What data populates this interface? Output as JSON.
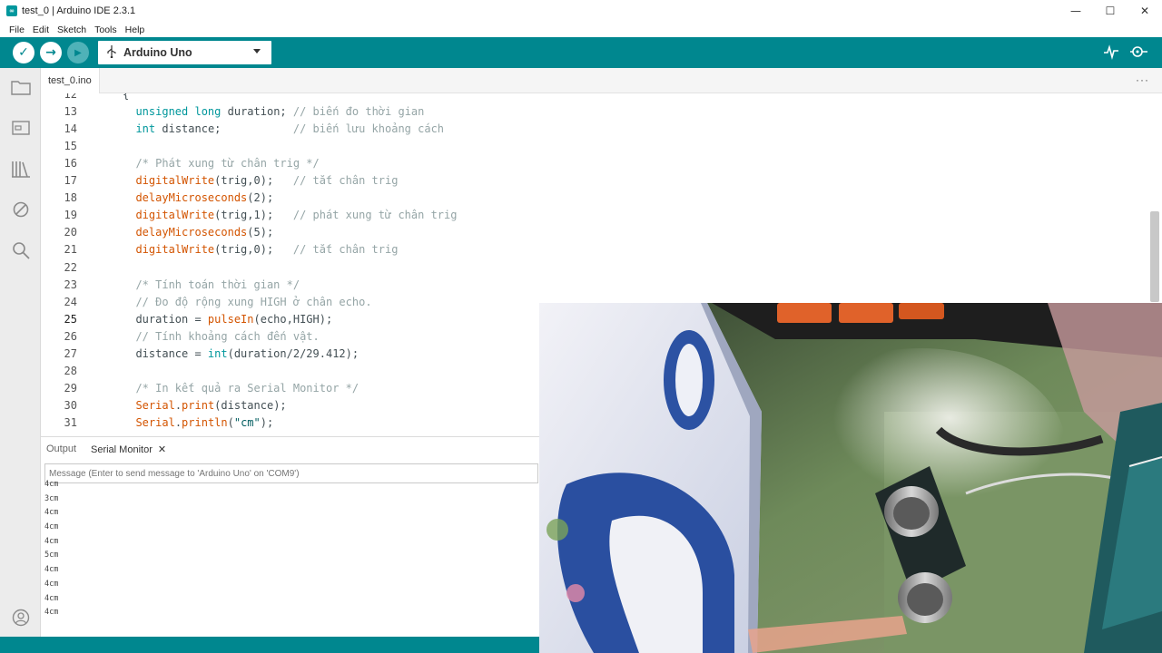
{
  "window": {
    "title": "test_0 | Arduino IDE 2.3.1",
    "logo": "arduino-logo-icon",
    "controls": {
      "minimize": "—",
      "maximize": "☐",
      "close": "✕"
    }
  },
  "menu": [
    "File",
    "Edit",
    "Sketch",
    "Tools",
    "Help"
  ],
  "toolbar": {
    "verify_icon": "✓",
    "upload_icon": "→",
    "debug_icon": "▶",
    "board_icon": "⭠",
    "board": "Arduino Uno",
    "plotter_icon": "⌁",
    "monitor_icon": "⚲"
  },
  "tabs": [
    {
      "label": "test_0.ino"
    }
  ],
  "tab_more": "···",
  "editor": {
    "current_line": "25",
    "lines": [
      {
        "n": "12",
        "code": "{"
      },
      {
        "n": "13",
        "code": "  unsigned long duration; // biến đo thời gian"
      },
      {
        "n": "14",
        "code": "  int distance;           // biến lưu khoảng cách"
      },
      {
        "n": "15",
        "code": ""
      },
      {
        "n": "16",
        "code": "  /* Phát xung từ chân trig */"
      },
      {
        "n": "17",
        "code": "  digitalWrite(trig,0);   // tắt chân trig"
      },
      {
        "n": "18",
        "code": "  delayMicroseconds(2);"
      },
      {
        "n": "19",
        "code": "  digitalWrite(trig,1);   // phát xung từ chân trig"
      },
      {
        "n": "20",
        "code": "  delayMicroseconds(5);"
      },
      {
        "n": "21",
        "code": "  digitalWrite(trig,0);   // tắt chân trig"
      },
      {
        "n": "22",
        "code": ""
      },
      {
        "n": "23",
        "code": "  /* Tính toán thời gian */"
      },
      {
        "n": "24",
        "code": "  // Đo độ rộng xung HIGH ở chân echo."
      },
      {
        "n": "25",
        "code": "  duration = pulseIn(echo,HIGH);"
      },
      {
        "n": "26",
        "code": "  // Tính khoảng cách đến vật."
      },
      {
        "n": "27",
        "code": "  distance = int(duration/2/29.412);"
      },
      {
        "n": "28",
        "code": ""
      },
      {
        "n": "29",
        "code": "  /* In kết quả ra Serial Monitor */"
      },
      {
        "n": "30",
        "code": "  Serial.print(distance);"
      },
      {
        "n": "31",
        "code": "  Serial.println(\"cm\");"
      }
    ]
  },
  "panel": {
    "tabs": [
      {
        "label": "Output",
        "active": false
      },
      {
        "label": "Serial Monitor",
        "active": true
      }
    ],
    "close_icon": "✕",
    "input_placeholder": "Message (Enter to send message to 'Arduino Uno' on 'COM9')",
    "output_lines": [
      "4cm",
      "3cm",
      "4cm",
      "4cm",
      "4cm",
      "5cm",
      "4cm",
      "4cm",
      "4cm",
      "4cm"
    ]
  },
  "sidebar_icons": [
    "sketchbook-icon",
    "boards-manager-icon",
    "library-manager-icon",
    "debug-icon",
    "search-icon",
    "profile-icon"
  ],
  "colors": {
    "toolbar": "#00878f",
    "keyword": "#00979c",
    "function": "#d35400",
    "comment": "#95a5a6"
  },
  "camera": {
    "description_icon": "ultrasonic-sensor-video-overlay"
  }
}
